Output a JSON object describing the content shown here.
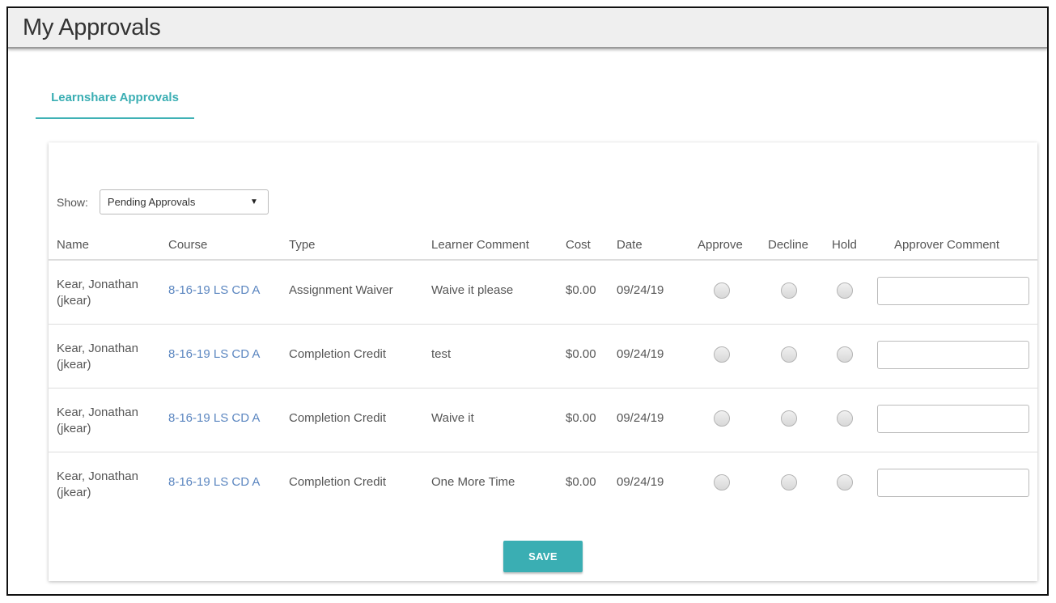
{
  "header": {
    "title": "My Approvals"
  },
  "tabs": [
    {
      "label": "Learnshare Approvals",
      "active": true
    }
  ],
  "filter": {
    "label": "Show:",
    "selected": "Pending Approvals"
  },
  "table": {
    "columns": [
      "Name",
      "Course",
      "Type",
      "Learner Comment",
      "Cost",
      "Date",
      "Approve",
      "Decline",
      "Hold",
      "Approver Comment"
    ],
    "rows": [
      {
        "name": "Kear, Jonathan (jkear)",
        "course": "8-16-19 LS CD A",
        "type": "Assignment Waiver",
        "comment": "Waive it please",
        "cost": "$0.00",
        "date": "09/24/19",
        "approver_comment": ""
      },
      {
        "name": "Kear, Jonathan (jkear)",
        "course": "8-16-19 LS CD A",
        "type": "Completion Credit",
        "comment": "test",
        "cost": "$0.00",
        "date": "09/24/19",
        "approver_comment": ""
      },
      {
        "name": "Kear, Jonathan (jkear)",
        "course": "8-16-19 LS CD A",
        "type": "Completion Credit",
        "comment": "Waive it",
        "cost": "$0.00",
        "date": "09/24/19",
        "approver_comment": ""
      },
      {
        "name": "Kear, Jonathan (jkear)",
        "course": "8-16-19 LS CD A",
        "type": "Completion Credit",
        "comment": "One More Time",
        "cost": "$0.00",
        "date": "09/24/19",
        "approver_comment": ""
      }
    ]
  },
  "actions": {
    "save_label": "SAVE"
  },
  "colors": {
    "accent": "#3aaeb3",
    "link": "#5b86c0",
    "header_bg": "#efefef"
  }
}
